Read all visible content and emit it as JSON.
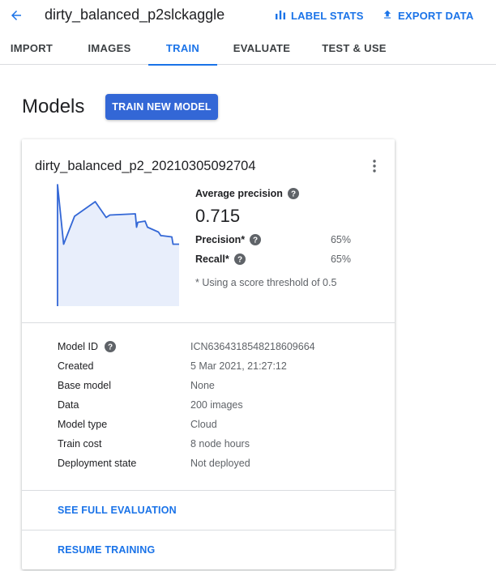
{
  "header": {
    "dataset_name": "dirty_balanced_p2slckaggle",
    "label_stats": "LABEL STATS",
    "export_data": "EXPORT DATA"
  },
  "tabs": [
    {
      "label": "IMPORT"
    },
    {
      "label": "IMAGES"
    },
    {
      "label": "TRAIN",
      "active": true
    },
    {
      "label": "EVALUATE"
    },
    {
      "label": "TEST & USE"
    }
  ],
  "page": {
    "heading": "Models",
    "train_button": "TRAIN NEW MODEL"
  },
  "model": {
    "name": "dirty_balanced_p2_20210305092704",
    "avg_precision_label": "Average precision",
    "avg_precision_value": "0.715",
    "precision_label": "Precision*",
    "precision_value": "65%",
    "recall_label": "Recall*",
    "recall_value": "65%",
    "footnote": "* Using a score threshold of 0.5",
    "details": [
      {
        "label": "Model ID",
        "value": "ICN6364318548218609664",
        "help": true
      },
      {
        "label": "Created",
        "value": "5 Mar 2021, 21:27:12"
      },
      {
        "label": "Base model",
        "value": "None"
      },
      {
        "label": "Data",
        "value": "200 images"
      },
      {
        "label": "Model type",
        "value": "Cloud"
      },
      {
        "label": "Train cost",
        "value": "8 node hours"
      },
      {
        "label": "Deployment state",
        "value": "Not deployed"
      }
    ],
    "see_full_evaluation": "SEE FULL EVALUATION",
    "resume_training": "RESUME TRAINING"
  },
  "chart_data": {
    "type": "area",
    "xlabel": "",
    "ylabel": "",
    "xlim": [
      0,
      1
    ],
    "ylim": [
      0,
      1
    ],
    "x": [
      0.0,
      0.0,
      0.05,
      0.14,
      0.31,
      0.4,
      0.43,
      0.64,
      0.65,
      0.66,
      0.72,
      0.74,
      0.83,
      0.85,
      0.86,
      0.94,
      0.95,
      1.0,
      1.0
    ],
    "y": [
      0.0,
      1.0,
      0.51,
      0.74,
      0.86,
      0.73,
      0.75,
      0.76,
      0.65,
      0.69,
      0.7,
      0.65,
      0.61,
      0.58,
      0.58,
      0.57,
      0.51,
      0.51,
      0.51
    ]
  },
  "colors": {
    "accent": "#1a73e8",
    "primary_button": "#3367d6",
    "chart_line": "#3367d6",
    "chart_fill": "#e8eefb"
  }
}
